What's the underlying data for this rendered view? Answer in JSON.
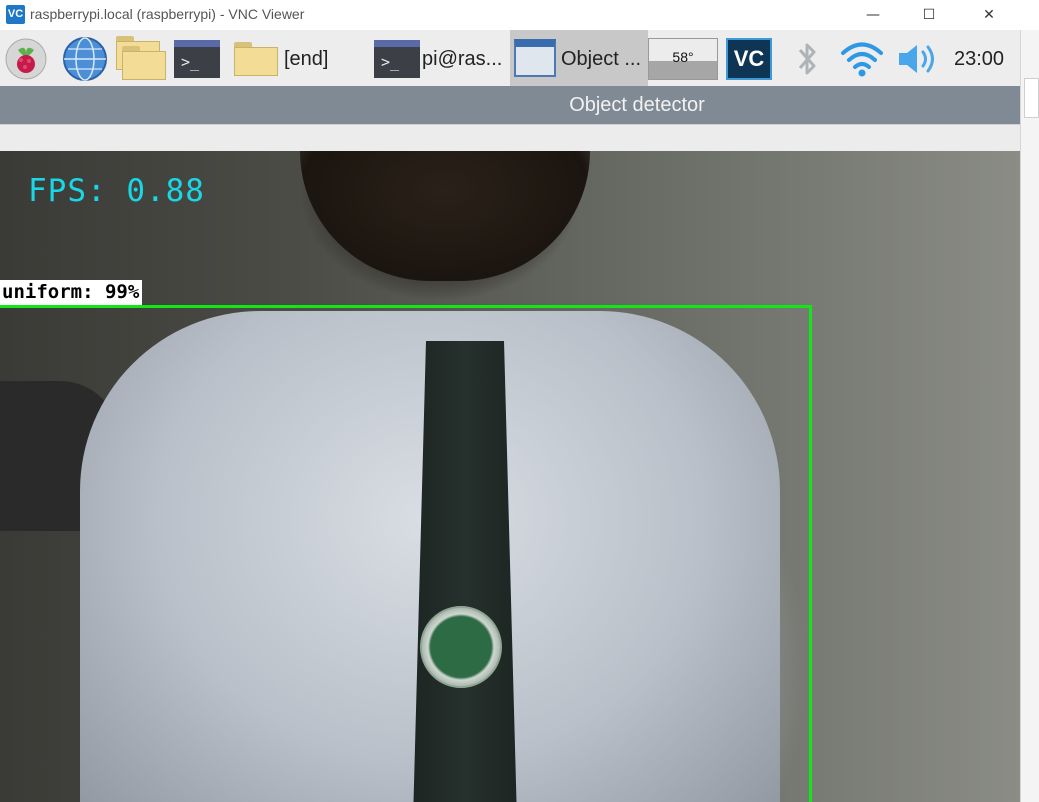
{
  "window": {
    "title": "raspberrypi.local (raspberrypi) - VNC Viewer",
    "logo": "VC",
    "minimize": "—",
    "maximize": "☐",
    "close": "✕"
  },
  "taskbar": {
    "items": [
      {
        "icon": "raspberry-menu-icon"
      },
      {
        "icon": "web-browser-globe-icon"
      },
      {
        "icon": "file-manager-folders-icon"
      },
      {
        "icon": "terminal-icon"
      },
      {
        "icon": "folder-icon",
        "label": "[end]"
      },
      {
        "icon": "terminal-icon",
        "label": "pi@ras..."
      },
      {
        "icon": "window-icon",
        "label": "Object ..."
      }
    ],
    "terminal_glyph": ">_",
    "cpu": "58°",
    "tray": {
      "vnc": "VC",
      "bluetooth_icon": "bluetooth-icon",
      "wifi_icon": "wifi-icon",
      "volume_icon": "volume-icon"
    },
    "clock": "23:00"
  },
  "app": {
    "title": "Object detector"
  },
  "video": {
    "fps_text": "FPS: 0.88",
    "detection": {
      "label": "uniform: 99%",
      "color": "#12e616"
    },
    "fps_color": "#19d7e6"
  }
}
